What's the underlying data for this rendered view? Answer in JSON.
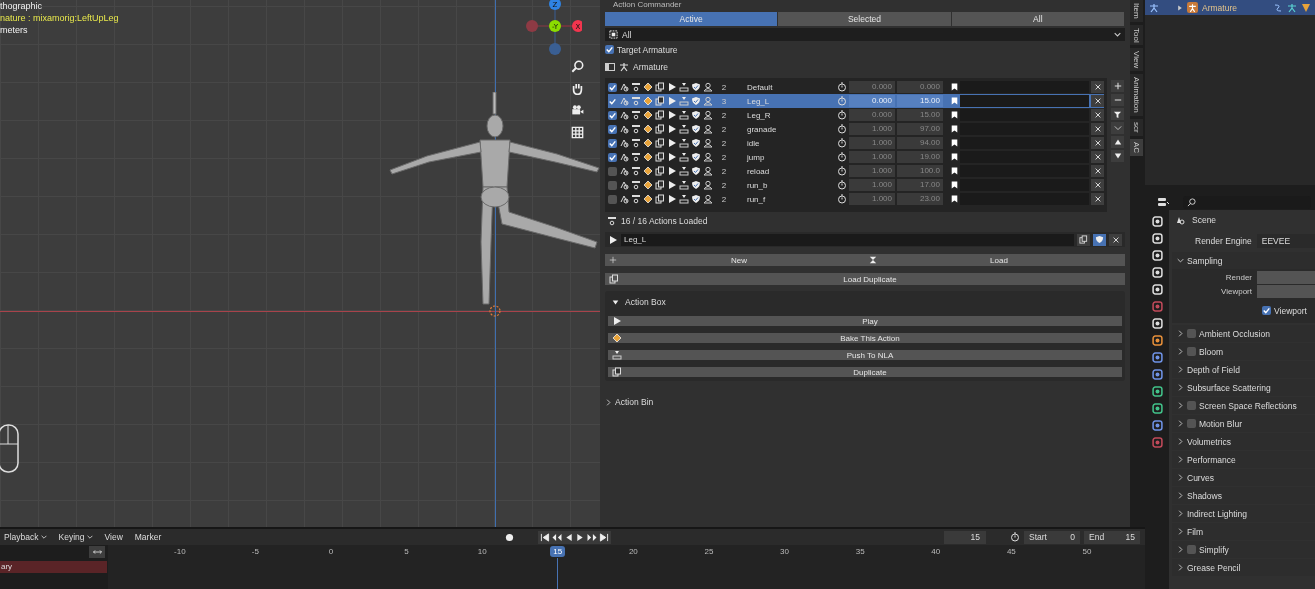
{
  "viewport": {
    "overlay": [
      {
        "text": "thographic",
        "kind": "info"
      },
      {
        "text": "nature : mixamorig:LeftUpLeg",
        "kind": "active"
      },
      {
        "text": "meters",
        "kind": "info"
      }
    ],
    "gizmo": [
      {
        "label": "Z",
        "color": "#2f83e3"
      },
      {
        "label": "-Y",
        "color": "#8bdc00"
      },
      {
        "label": "X",
        "color": "#f2354e"
      }
    ]
  },
  "panel": {
    "title": "Action Commander",
    "tabs": [
      {
        "label": "Active",
        "selected": true
      },
      {
        "label": "Selected",
        "selected": false
      },
      {
        "label": "All",
        "selected": false
      }
    ],
    "filter": "All",
    "target_armature": {
      "label": "Target Armature",
      "checked": true
    },
    "armature": "Armature",
    "actions": [
      {
        "checked": true,
        "count": "2",
        "name": "Default",
        "start": "0.000",
        "end": "0.000",
        "selected": false
      },
      {
        "checked": true,
        "count": "3",
        "name": "Leg_L",
        "start": "0.000",
        "end": "15.00",
        "selected": true
      },
      {
        "checked": true,
        "count": "2",
        "name": "Leg_R",
        "start": "0.000",
        "end": "15.00",
        "selected": false
      },
      {
        "checked": true,
        "count": "2",
        "name": "granade",
        "start": "1.000",
        "end": "97.00",
        "selected": false
      },
      {
        "checked": true,
        "count": "2",
        "name": "idle",
        "start": "1.000",
        "end": "94.00",
        "selected": false
      },
      {
        "checked": true,
        "count": "2",
        "name": "jump",
        "start": "1.000",
        "end": "19.00",
        "selected": false
      },
      {
        "checked": false,
        "count": "2",
        "name": "reload",
        "start": "1.000",
        "end": "100.0",
        "selected": false
      },
      {
        "checked": false,
        "count": "2",
        "name": "run_b",
        "start": "1.000",
        "end": "17.00",
        "selected": false
      },
      {
        "checked": false,
        "count": "2",
        "name": "run_f",
        "start": "1.000",
        "end": "23.00",
        "selected": false
      }
    ],
    "status": "16 / 16 Actions Loaded",
    "current_action": "Leg_L",
    "new_label": "New",
    "load_label": "Load",
    "load_duplicate_label": "Load Duplicate",
    "action_box": {
      "title": "Action Box",
      "expanded": true,
      "buttons": [
        {
          "label": "Play",
          "kind": "play"
        },
        {
          "label": "Bake This Action",
          "kind": "bake"
        },
        {
          "label": "Push To NLA",
          "kind": "push"
        },
        {
          "label": "Duplicate",
          "kind": "duplicate"
        }
      ]
    },
    "action_bin": {
      "title": "Action Bin",
      "expanded": false
    }
  },
  "side_tabs": [
    {
      "label": "Item",
      "selected": false
    },
    {
      "label": "Tool",
      "selected": false
    },
    {
      "label": "View",
      "selected": false
    },
    {
      "label": "Animation",
      "selected": false
    },
    {
      "label": "scr",
      "selected": false
    },
    {
      "label": "AC",
      "selected": true
    }
  ],
  "outliner": {
    "item": "Armature",
    "selected": true
  },
  "properties": {
    "context": "Scene",
    "render_engine": {
      "label": "Render Engine",
      "value": "EEVEE"
    },
    "sampling": {
      "title": "Sampling",
      "expanded": true,
      "fields": [
        "Render",
        "Viewport"
      ],
      "checkbox": {
        "label": "Viewport",
        "checked": true
      }
    },
    "panels": [
      {
        "title": "Ambient Occlusion",
        "kind": "toggle",
        "checked": false
      },
      {
        "title": "Bloom",
        "kind": "toggle",
        "checked": false
      },
      {
        "title": "Depth of Field",
        "kind": "plain"
      },
      {
        "title": "Subsurface Scattering",
        "kind": "plain"
      },
      {
        "title": "Screen Space Reflections",
        "kind": "toggle",
        "checked": false
      },
      {
        "title": "Motion Blur",
        "kind": "toggle",
        "checked": false
      },
      {
        "title": "Volumetrics",
        "kind": "plain"
      },
      {
        "title": "Performance",
        "kind": "plain"
      },
      {
        "title": "Curves",
        "kind": "plain"
      },
      {
        "title": "Shadows",
        "kind": "plain"
      },
      {
        "title": "Indirect Lighting",
        "kind": "plain"
      },
      {
        "title": "Film",
        "kind": "plain"
      },
      {
        "title": "Simplify",
        "kind": "toggle",
        "checked": false
      },
      {
        "title": "Grease Pencil",
        "kind": "plain"
      }
    ]
  },
  "timeline": {
    "menus": [
      {
        "label": "Playback",
        "dropdown": true
      },
      {
        "label": "Keying",
        "dropdown": true
      },
      {
        "label": "View",
        "dropdown": false
      },
      {
        "label": "Marker",
        "dropdown": false
      }
    ],
    "current_frame": "15",
    "start": {
      "label": "Start",
      "value": "0"
    },
    "end": {
      "label": "End",
      "value": "15"
    },
    "channel": "ary",
    "ruler": [
      {
        "label": "-10",
        "selected": false
      },
      {
        "label": "-5",
        "selected": false
      },
      {
        "label": "0",
        "selected": false
      },
      {
        "label": "5",
        "selected": false
      },
      {
        "label": "10",
        "selected": false
      },
      {
        "label": "15",
        "selected": true
      },
      {
        "label": "20",
        "selected": false
      },
      {
        "label": "25",
        "selected": false
      },
      {
        "label": "30",
        "selected": false
      },
      {
        "label": "35",
        "selected": false
      },
      {
        "label": "40",
        "selected": false
      },
      {
        "label": "45",
        "selected": false
      },
      {
        "label": "50",
        "selected": false
      }
    ]
  }
}
